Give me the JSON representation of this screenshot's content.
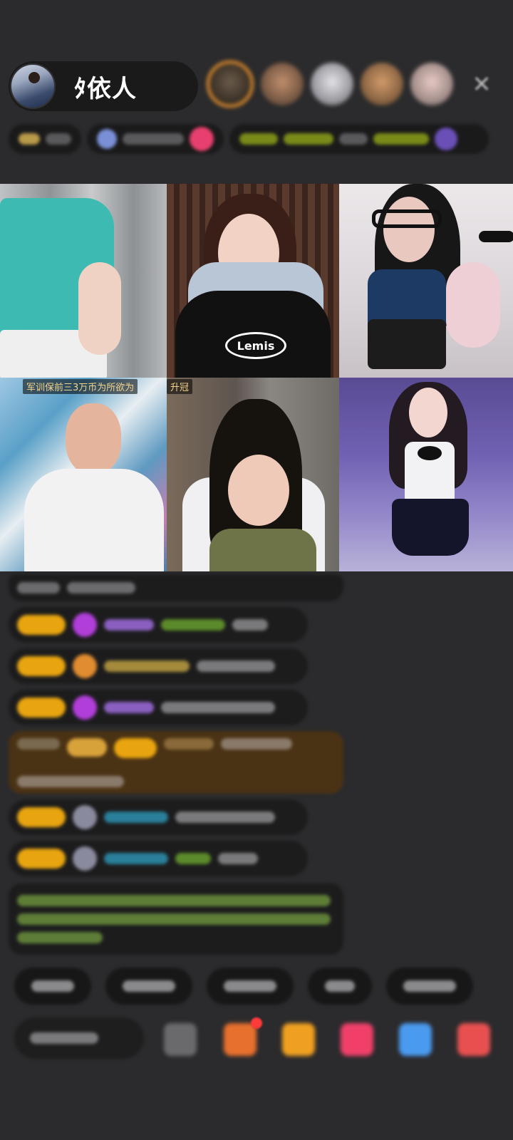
{
  "host": {
    "name": "ﾀ依人",
    "avatar_icon": "host-avatar"
  },
  "audience_icons": [
    "audience-avatar-1",
    "audience-avatar-2",
    "audience-avatar-3",
    "audience-avatar-4",
    "audience-avatar-5"
  ],
  "close_icon": "close-icon",
  "grid": {
    "tiles": [
      {
        "name": "guest-1"
      },
      {
        "name": "guest-2",
        "shirt_text": "Lemis"
      },
      {
        "name": "guest-3"
      },
      {
        "name": "guest-4",
        "label": "军训保前三3万币为所欲为"
      },
      {
        "name": "guest-5",
        "label": "升冠"
      },
      {
        "name": "guest-6"
      }
    ]
  },
  "colors": {
    "background": "#2b2b2d",
    "badge": "#e8a510",
    "gem": "#b13ed8",
    "green_text": "#7ec241",
    "cyan_text": "#27a2c9",
    "highlight_row": "#4a3214"
  }
}
